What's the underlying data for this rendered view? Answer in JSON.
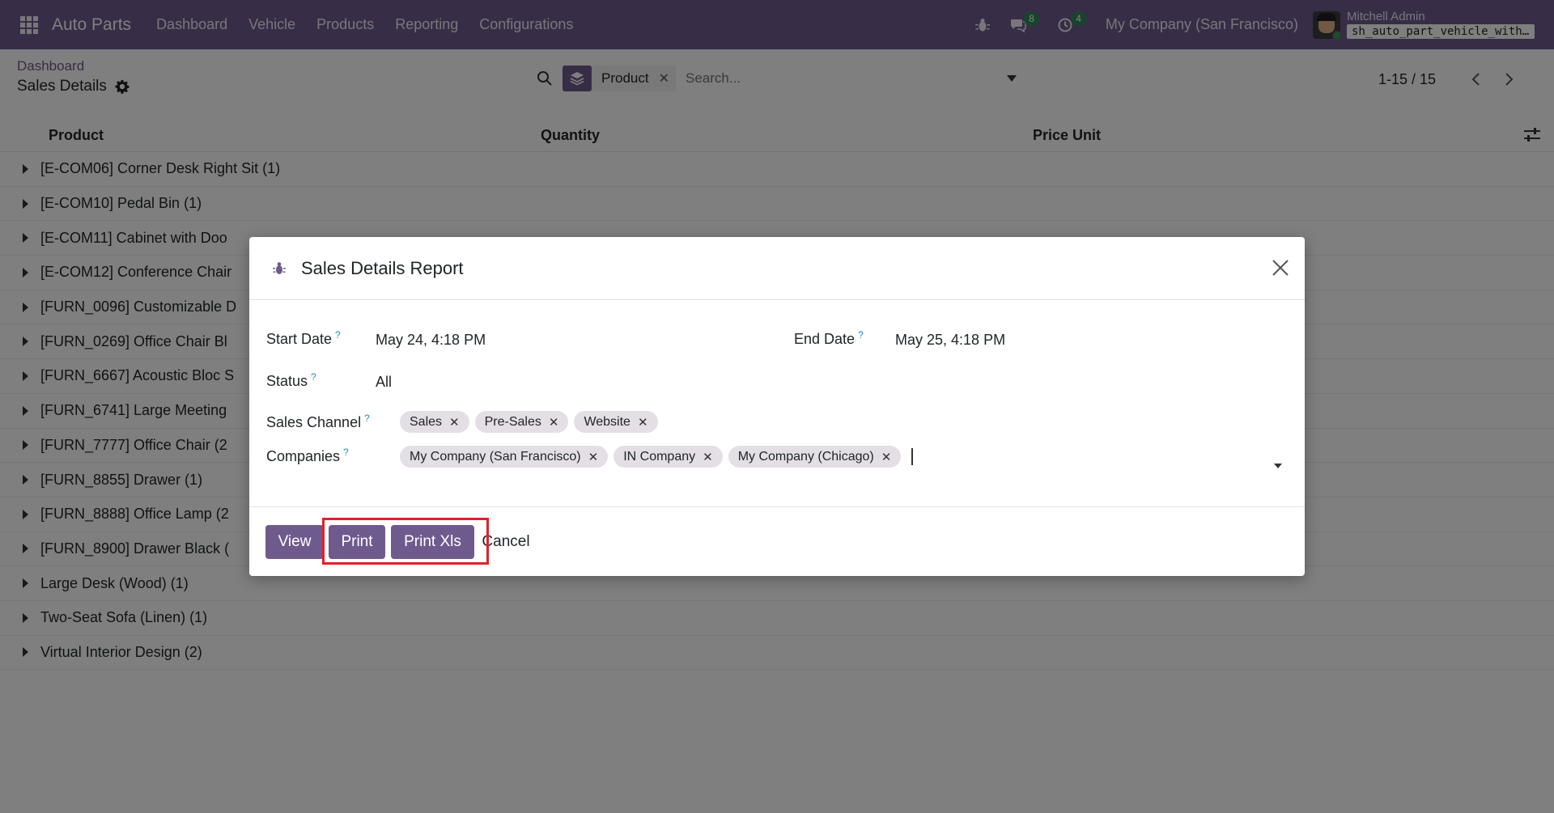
{
  "navbar": {
    "app_name": "Auto Parts",
    "menu": [
      "Dashboard",
      "Vehicle",
      "Products",
      "Reporting",
      "Configurations"
    ],
    "messages_count": "8",
    "activities_count": "4",
    "company": "My Company (San Francisco)",
    "user_name": "Mitchell Admin",
    "database": "sh_auto_part_vehicle_with_demo"
  },
  "control_panel": {
    "breadcrumb": "Dashboard",
    "title": "Sales Details",
    "facet_label": "Product",
    "search_placeholder": "Search...",
    "pager": "1-15 / 15"
  },
  "list": {
    "columns": [
      "Product",
      "Quantity",
      "Price Unit"
    ],
    "groups": [
      "[E-COM06] Corner Desk Right Sit (1)",
      "[E-COM10] Pedal Bin (1)",
      "[E-COM11] Cabinet with Doo",
      "[E-COM12] Conference Chair",
      "[FURN_0096] Customizable D",
      "[FURN_0269] Office Chair Bl",
      "[FURN_6667] Acoustic Bloc S",
      "[FURN_6741] Large Meeting",
      "[FURN_7777] Office Chair (2",
      "[FURN_8855] Drawer (1)",
      "[FURN_8888] Office Lamp (2",
      "[FURN_8900] Drawer Black (",
      "Large Desk (Wood) (1)",
      "Two-Seat Sofa (Linen) (1)",
      "Virtual Interior Design (2)"
    ]
  },
  "modal": {
    "title": "Sales Details Report",
    "start_date_label": "Start Date",
    "start_date": "May 24, 4:18 PM",
    "end_date_label": "End Date",
    "end_date": "May 25, 4:18 PM",
    "status_label": "Status",
    "status": "All",
    "sales_channel_label": "Sales Channel",
    "sales_channels": [
      "Sales",
      "Pre-Sales",
      "Website"
    ],
    "companies_label": "Companies",
    "companies": [
      "My Company (San Francisco)",
      "IN Company",
      "My Company (Chicago)"
    ],
    "help_mark": "?",
    "buttons": {
      "view": "View",
      "print": "Print",
      "print_xls": "Print Xls",
      "cancel": "Cancel"
    }
  },
  "colors": {
    "navbar": "#6f5a8e",
    "primary": "#6f5a8e",
    "highlight": "#e0202a"
  }
}
